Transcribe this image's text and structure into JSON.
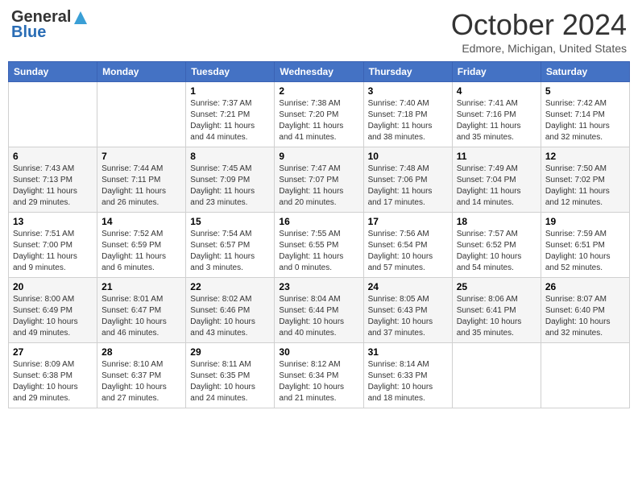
{
  "header": {
    "logo": {
      "line1": "General",
      "line2": "Blue"
    },
    "title": "October 2024",
    "subtitle": "Edmore, Michigan, United States"
  },
  "weekdays": [
    "Sunday",
    "Monday",
    "Tuesday",
    "Wednesday",
    "Thursday",
    "Friday",
    "Saturday"
  ],
  "weeks": [
    [
      null,
      null,
      {
        "day": 1,
        "sunrise": "7:37 AM",
        "sunset": "7:21 PM",
        "daylight": "11 hours and 44 minutes."
      },
      {
        "day": 2,
        "sunrise": "7:38 AM",
        "sunset": "7:20 PM",
        "daylight": "11 hours and 41 minutes."
      },
      {
        "day": 3,
        "sunrise": "7:40 AM",
        "sunset": "7:18 PM",
        "daylight": "11 hours and 38 minutes."
      },
      {
        "day": 4,
        "sunrise": "7:41 AM",
        "sunset": "7:16 PM",
        "daylight": "11 hours and 35 minutes."
      },
      {
        "day": 5,
        "sunrise": "7:42 AM",
        "sunset": "7:14 PM",
        "daylight": "11 hours and 32 minutes."
      }
    ],
    [
      {
        "day": 6,
        "sunrise": "7:43 AM",
        "sunset": "7:13 PM",
        "daylight": "11 hours and 29 minutes."
      },
      {
        "day": 7,
        "sunrise": "7:44 AM",
        "sunset": "7:11 PM",
        "daylight": "11 hours and 26 minutes."
      },
      {
        "day": 8,
        "sunrise": "7:45 AM",
        "sunset": "7:09 PM",
        "daylight": "11 hours and 23 minutes."
      },
      {
        "day": 9,
        "sunrise": "7:47 AM",
        "sunset": "7:07 PM",
        "daylight": "11 hours and 20 minutes."
      },
      {
        "day": 10,
        "sunrise": "7:48 AM",
        "sunset": "7:06 PM",
        "daylight": "11 hours and 17 minutes."
      },
      {
        "day": 11,
        "sunrise": "7:49 AM",
        "sunset": "7:04 PM",
        "daylight": "11 hours and 14 minutes."
      },
      {
        "day": 12,
        "sunrise": "7:50 AM",
        "sunset": "7:02 PM",
        "daylight": "11 hours and 12 minutes."
      }
    ],
    [
      {
        "day": 13,
        "sunrise": "7:51 AM",
        "sunset": "7:00 PM",
        "daylight": "11 hours and 9 minutes."
      },
      {
        "day": 14,
        "sunrise": "7:52 AM",
        "sunset": "6:59 PM",
        "daylight": "11 hours and 6 minutes."
      },
      {
        "day": 15,
        "sunrise": "7:54 AM",
        "sunset": "6:57 PM",
        "daylight": "11 hours and 3 minutes."
      },
      {
        "day": 16,
        "sunrise": "7:55 AM",
        "sunset": "6:55 PM",
        "daylight": "11 hours and 0 minutes."
      },
      {
        "day": 17,
        "sunrise": "7:56 AM",
        "sunset": "6:54 PM",
        "daylight": "10 hours and 57 minutes."
      },
      {
        "day": 18,
        "sunrise": "7:57 AM",
        "sunset": "6:52 PM",
        "daylight": "10 hours and 54 minutes."
      },
      {
        "day": 19,
        "sunrise": "7:59 AM",
        "sunset": "6:51 PM",
        "daylight": "10 hours and 52 minutes."
      }
    ],
    [
      {
        "day": 20,
        "sunrise": "8:00 AM",
        "sunset": "6:49 PM",
        "daylight": "10 hours and 49 minutes."
      },
      {
        "day": 21,
        "sunrise": "8:01 AM",
        "sunset": "6:47 PM",
        "daylight": "10 hours and 46 minutes."
      },
      {
        "day": 22,
        "sunrise": "8:02 AM",
        "sunset": "6:46 PM",
        "daylight": "10 hours and 43 minutes."
      },
      {
        "day": 23,
        "sunrise": "8:04 AM",
        "sunset": "6:44 PM",
        "daylight": "10 hours and 40 minutes."
      },
      {
        "day": 24,
        "sunrise": "8:05 AM",
        "sunset": "6:43 PM",
        "daylight": "10 hours and 37 minutes."
      },
      {
        "day": 25,
        "sunrise": "8:06 AM",
        "sunset": "6:41 PM",
        "daylight": "10 hours and 35 minutes."
      },
      {
        "day": 26,
        "sunrise": "8:07 AM",
        "sunset": "6:40 PM",
        "daylight": "10 hours and 32 minutes."
      }
    ],
    [
      {
        "day": 27,
        "sunrise": "8:09 AM",
        "sunset": "6:38 PM",
        "daylight": "10 hours and 29 minutes."
      },
      {
        "day": 28,
        "sunrise": "8:10 AM",
        "sunset": "6:37 PM",
        "daylight": "10 hours and 27 minutes."
      },
      {
        "day": 29,
        "sunrise": "8:11 AM",
        "sunset": "6:35 PM",
        "daylight": "10 hours and 24 minutes."
      },
      {
        "day": 30,
        "sunrise": "8:12 AM",
        "sunset": "6:34 PM",
        "daylight": "10 hours and 21 minutes."
      },
      {
        "day": 31,
        "sunrise": "8:14 AM",
        "sunset": "6:33 PM",
        "daylight": "10 hours and 18 minutes."
      },
      null,
      null
    ]
  ]
}
